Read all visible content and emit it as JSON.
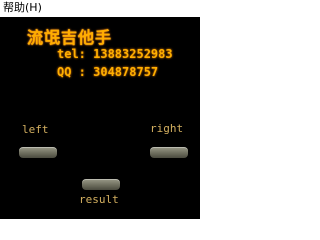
{
  "menubar": {
    "help_label": "帮助(H)"
  },
  "banner": {
    "title": "流氓吉他手",
    "tel_line": "tel: 13883252983",
    "qq_line": "QQ : 304878757"
  },
  "controls": {
    "left_label": "left",
    "right_label": "right",
    "result_label": "result"
  },
  "colors": {
    "background": "#000000",
    "menubar": "#ffffff",
    "banner_text": "#ffae00",
    "label_text": "#d4b060",
    "pad": "#7a7a6a"
  }
}
